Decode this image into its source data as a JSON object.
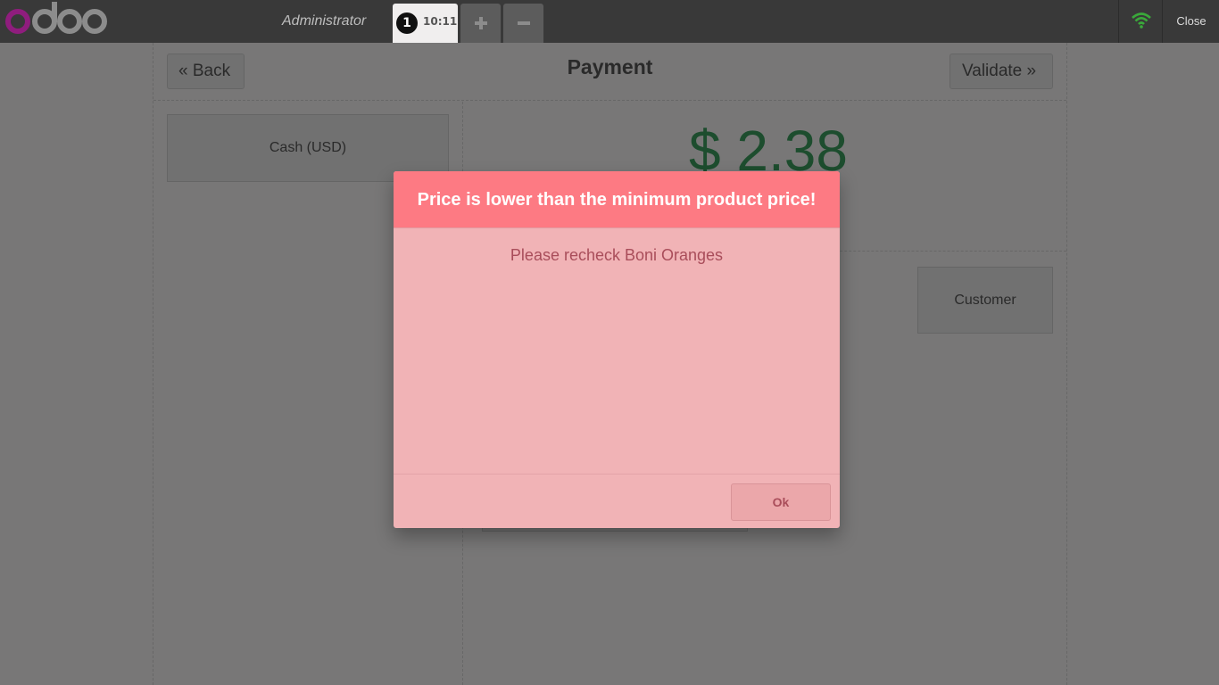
{
  "topbar": {
    "user_name": "Administrator",
    "order_number": "1",
    "order_time": "10:11",
    "close_label": "Close",
    "wifi_color": "#3aa93a"
  },
  "payment": {
    "title": "Payment",
    "back_label": "Back",
    "validate_label": "Validate",
    "payment_method": "Cash (USD)",
    "total": "$ 2.38",
    "customer_label": "Customer"
  },
  "popup": {
    "title": "Price is lower than the minimum product price!",
    "body": "Please recheck Boni Oranges",
    "ok_label": "Ok"
  },
  "colors": {
    "brand_primary": "#875a7b",
    "popup_title_bg": "#fd7a83",
    "popup_bg": "#f1b3b6",
    "total_green": "#3a9a5c"
  }
}
